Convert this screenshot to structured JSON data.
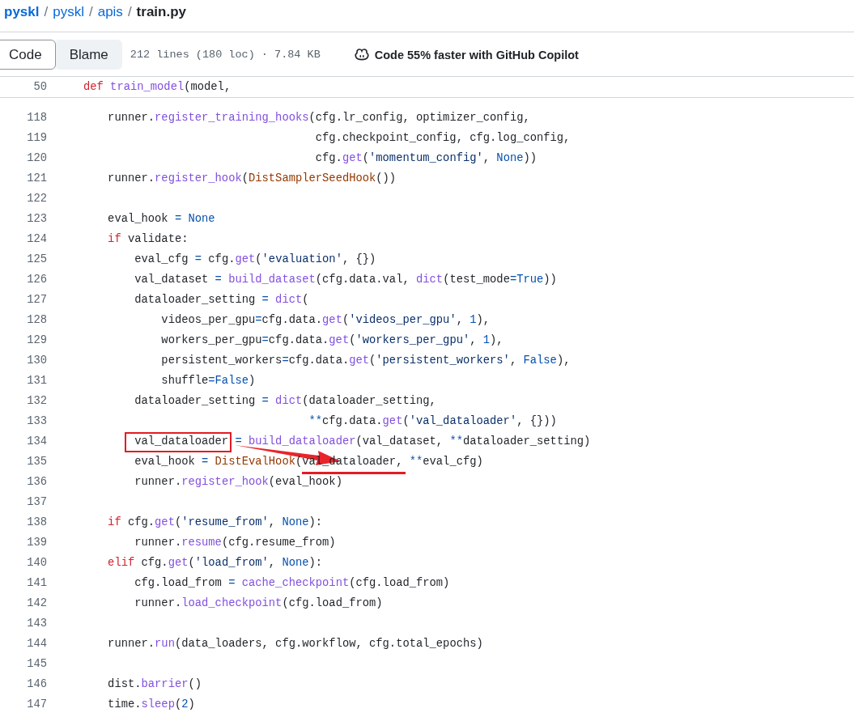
{
  "breadcrumb": {
    "separator": "/",
    "items": [
      {
        "label": "pyskl",
        "kind": "repo"
      },
      {
        "label": "pyskl",
        "kind": "link"
      },
      {
        "label": "apis",
        "kind": "link"
      },
      {
        "label": "train.py",
        "kind": "current"
      }
    ]
  },
  "tabs": [
    {
      "label": "Code",
      "selected": true
    },
    {
      "label": "Blame",
      "selected": false
    }
  ],
  "file_info": "212 lines (180 loc) · 7.84 KB",
  "copilot": "Code 55% faster with GitHub Copilot",
  "sticky_line": {
    "n": "50",
    "tokens": [
      {
        "t": "def",
        "kind": "kw"
      },
      {
        "t": " train_model",
        "kind": "fn"
      },
      {
        "t": "(model,",
        "kind": "plain"
      }
    ]
  },
  "lines": [
    {
      "n": "118",
      "tokens": [
        {
          "t": "    runner.",
          "kind": "plain"
        },
        {
          "t": "register_training_hooks",
          "kind": "fn"
        },
        {
          "t": "(cfg.lr_config, optimizer_config,",
          "kind": "plain"
        }
      ]
    },
    {
      "n": "119",
      "tokens": [
        {
          "t": "                                   cfg.checkpoint_config, cfg.log_config,",
          "kind": "plain"
        }
      ]
    },
    {
      "n": "120",
      "tokens": [
        {
          "t": "                                   cfg.",
          "kind": "plain"
        },
        {
          "t": "get",
          "kind": "fn"
        },
        {
          "t": "(",
          "kind": "plain"
        },
        {
          "t": "'momentum_config'",
          "kind": "str"
        },
        {
          "t": ", ",
          "kind": "plain"
        },
        {
          "t": "None",
          "kind": "const"
        },
        {
          "t": "))",
          "kind": "plain"
        }
      ]
    },
    {
      "n": "121",
      "tokens": [
        {
          "t": "    runner.",
          "kind": "plain"
        },
        {
          "t": "register_hook",
          "kind": "fn"
        },
        {
          "t": "(",
          "kind": "plain"
        },
        {
          "t": "DistSamplerSeedHook",
          "kind": "cls"
        },
        {
          "t": "())",
          "kind": "plain"
        }
      ]
    },
    {
      "n": "122"
    },
    {
      "n": "123",
      "tokens": [
        {
          "t": "    eval_hook ",
          "kind": "plain"
        },
        {
          "t": "=",
          "kind": "op"
        },
        {
          "t": " None",
          "kind": "const"
        }
      ]
    },
    {
      "n": "124",
      "tokens": [
        {
          "t": "    if",
          "kind": "kw"
        },
        {
          "t": " validate:",
          "kind": "plain"
        }
      ]
    },
    {
      "n": "125",
      "tokens": [
        {
          "t": "        eval_cfg ",
          "kind": "plain"
        },
        {
          "t": "=",
          "kind": "op"
        },
        {
          "t": " cfg.",
          "kind": "plain"
        },
        {
          "t": "get",
          "kind": "fn"
        },
        {
          "t": "(",
          "kind": "plain"
        },
        {
          "t": "'evaluation'",
          "kind": "str"
        },
        {
          "t": ", {})",
          "kind": "plain"
        }
      ]
    },
    {
      "n": "126",
      "tokens": [
        {
          "t": "        val_dataset ",
          "kind": "plain"
        },
        {
          "t": "=",
          "kind": "op"
        },
        {
          "t": " build_dataset",
          "kind": "fn"
        },
        {
          "t": "(cfg.data.val, ",
          "kind": "plain"
        },
        {
          "t": "dict",
          "kind": "fn"
        },
        {
          "t": "(test_mode",
          "kind": "plain"
        },
        {
          "t": "=",
          "kind": "op"
        },
        {
          "t": "True",
          "kind": "const"
        },
        {
          "t": "))",
          "kind": "plain"
        }
      ]
    },
    {
      "n": "127",
      "tokens": [
        {
          "t": "        dataloader_setting ",
          "kind": "plain"
        },
        {
          "t": "=",
          "kind": "op"
        },
        {
          "t": " dict",
          "kind": "fn"
        },
        {
          "t": "(",
          "kind": "plain"
        }
      ]
    },
    {
      "n": "128",
      "tokens": [
        {
          "t": "            videos_per_gpu",
          "kind": "plain"
        },
        {
          "t": "=",
          "kind": "op"
        },
        {
          "t": "cfg.data.",
          "kind": "plain"
        },
        {
          "t": "get",
          "kind": "fn"
        },
        {
          "t": "(",
          "kind": "plain"
        },
        {
          "t": "'videos_per_gpu'",
          "kind": "str"
        },
        {
          "t": ", ",
          "kind": "plain"
        },
        {
          "t": "1",
          "kind": "const"
        },
        {
          "t": "),",
          "kind": "plain"
        }
      ]
    },
    {
      "n": "129",
      "tokens": [
        {
          "t": "            workers_per_gpu",
          "kind": "plain"
        },
        {
          "t": "=",
          "kind": "op"
        },
        {
          "t": "cfg.data.",
          "kind": "plain"
        },
        {
          "t": "get",
          "kind": "fn"
        },
        {
          "t": "(",
          "kind": "plain"
        },
        {
          "t": "'workers_per_gpu'",
          "kind": "str"
        },
        {
          "t": ", ",
          "kind": "plain"
        },
        {
          "t": "1",
          "kind": "const"
        },
        {
          "t": "),",
          "kind": "plain"
        }
      ]
    },
    {
      "n": "130",
      "tokens": [
        {
          "t": "            persistent_workers",
          "kind": "plain"
        },
        {
          "t": "=",
          "kind": "op"
        },
        {
          "t": "cfg.data.",
          "kind": "plain"
        },
        {
          "t": "get",
          "kind": "fn"
        },
        {
          "t": "(",
          "kind": "plain"
        },
        {
          "t": "'persistent_workers'",
          "kind": "str"
        },
        {
          "t": ", ",
          "kind": "plain"
        },
        {
          "t": "False",
          "kind": "const"
        },
        {
          "t": "),",
          "kind": "plain"
        }
      ]
    },
    {
      "n": "131",
      "tokens": [
        {
          "t": "            shuffle",
          "kind": "plain"
        },
        {
          "t": "=",
          "kind": "op"
        },
        {
          "t": "False",
          "kind": "const"
        },
        {
          "t": ")",
          "kind": "plain"
        }
      ]
    },
    {
      "n": "132",
      "tokens": [
        {
          "t": "        dataloader_setting ",
          "kind": "plain"
        },
        {
          "t": "=",
          "kind": "op"
        },
        {
          "t": " dict",
          "kind": "fn"
        },
        {
          "t": "(dataloader_setting,",
          "kind": "plain"
        }
      ]
    },
    {
      "n": "133",
      "tokens": [
        {
          "t": "                                  **",
          "kind": "op"
        },
        {
          "t": "cfg.data.",
          "kind": "plain"
        },
        {
          "t": "get",
          "kind": "fn"
        },
        {
          "t": "(",
          "kind": "plain"
        },
        {
          "t": "'val_dataloader'",
          "kind": "str"
        },
        {
          "t": ", {}))",
          "kind": "plain"
        }
      ]
    },
    {
      "n": "134",
      "tokens": [
        {
          "t": "        val_dataloader",
          "kind": "plain",
          "boxed": true
        },
        {
          "t": " =",
          "kind": "op"
        },
        {
          "t": " build_dataloader",
          "kind": "fn"
        },
        {
          "t": "(val_dataset, ",
          "kind": "plain"
        },
        {
          "t": "**",
          "kind": "op"
        },
        {
          "t": "dataloader_setting)",
          "kind": "plain"
        }
      ]
    },
    {
      "n": "135",
      "tokens": [
        {
          "t": "        eval_hook ",
          "kind": "plain"
        },
        {
          "t": "=",
          "kind": "op"
        },
        {
          "t": " DistEvalHook",
          "kind": "cls"
        },
        {
          "t": "(",
          "kind": "plain"
        },
        {
          "t": "val_dataloader, ",
          "kind": "plain",
          "underlined": true
        },
        {
          "t": "**",
          "kind": "op"
        },
        {
          "t": "eval_cfg)",
          "kind": "plain"
        }
      ]
    },
    {
      "n": "136",
      "tokens": [
        {
          "t": "        runner.",
          "kind": "plain"
        },
        {
          "t": "register_hook",
          "kind": "fn"
        },
        {
          "t": "(eval_hook)",
          "kind": "plain"
        }
      ]
    },
    {
      "n": "137"
    },
    {
      "n": "138",
      "tokens": [
        {
          "t": "    if",
          "kind": "kw"
        },
        {
          "t": " cfg.",
          "kind": "plain"
        },
        {
          "t": "get",
          "kind": "fn"
        },
        {
          "t": "(",
          "kind": "plain"
        },
        {
          "t": "'resume_from'",
          "kind": "str"
        },
        {
          "t": ", ",
          "kind": "plain"
        },
        {
          "t": "None",
          "kind": "const"
        },
        {
          "t": "):",
          "kind": "plain"
        }
      ]
    },
    {
      "n": "139",
      "tokens": [
        {
          "t": "        runner.",
          "kind": "plain"
        },
        {
          "t": "resume",
          "kind": "fn"
        },
        {
          "t": "(cfg.resume_from)",
          "kind": "plain"
        }
      ]
    },
    {
      "n": "140",
      "tokens": [
        {
          "t": "    elif",
          "kind": "kw"
        },
        {
          "t": " cfg.",
          "kind": "plain"
        },
        {
          "t": "get",
          "kind": "fn"
        },
        {
          "t": "(",
          "kind": "plain"
        },
        {
          "t": "'load_from'",
          "kind": "str"
        },
        {
          "t": ", ",
          "kind": "plain"
        },
        {
          "t": "None",
          "kind": "const"
        },
        {
          "t": "):",
          "kind": "plain"
        }
      ]
    },
    {
      "n": "141",
      "tokens": [
        {
          "t": "        cfg.load_from ",
          "kind": "plain"
        },
        {
          "t": "=",
          "kind": "op"
        },
        {
          "t": " cache_checkpoint",
          "kind": "fn"
        },
        {
          "t": "(cfg.load_from)",
          "kind": "plain"
        }
      ]
    },
    {
      "n": "142",
      "tokens": [
        {
          "t": "        runner.",
          "kind": "plain"
        },
        {
          "t": "load_checkpoint",
          "kind": "fn"
        },
        {
          "t": "(cfg.load_from)",
          "kind": "plain"
        }
      ]
    },
    {
      "n": "143"
    },
    {
      "n": "144",
      "tokens": [
        {
          "t": "    runner.",
          "kind": "plain"
        },
        {
          "t": "run",
          "kind": "fn"
        },
        {
          "t": "(data_loaders, cfg.workflow, cfg.total_epochs)",
          "kind": "plain"
        }
      ]
    },
    {
      "n": "145"
    },
    {
      "n": "146",
      "tokens": [
        {
          "t": "    dist.",
          "kind": "plain"
        },
        {
          "t": "barrier",
          "kind": "fn"
        },
        {
          "t": "()",
          "kind": "plain"
        }
      ]
    },
    {
      "n": "147",
      "tokens": [
        {
          "t": "    time.",
          "kind": "plain"
        },
        {
          "t": "sleep",
          "kind": "fn"
        },
        {
          "t": "(",
          "kind": "plain"
        },
        {
          "t": "2",
          "kind": "const"
        },
        {
          "t": ")",
          "kind": "plain"
        }
      ]
    }
  ],
  "annotation_arrow": true
}
